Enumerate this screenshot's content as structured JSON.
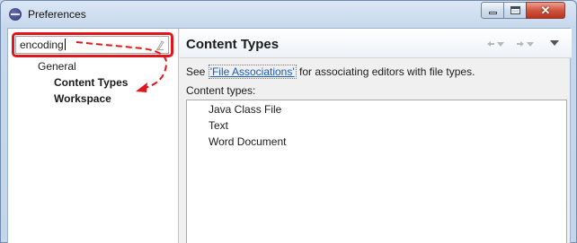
{
  "window": {
    "title": "Preferences",
    "minimize_icon": "minimize-icon",
    "maximize_icon": "maximize-icon",
    "close_icon": "close-icon"
  },
  "filter": {
    "value": "encoding",
    "clear_icon": "eraser-icon"
  },
  "annotation": {
    "highlight_color": "#e0161b"
  },
  "tree": {
    "items": [
      {
        "label": "General",
        "level": 0,
        "bold": false
      },
      {
        "label": "Content Types",
        "level": 1,
        "bold": true
      },
      {
        "label": "Workspace",
        "level": 1,
        "bold": true
      }
    ]
  },
  "page": {
    "title": "Content Types",
    "see_prefix": "See ",
    "see_link": "'File Associations'",
    "see_suffix": " for associating editors with file types.",
    "content_types_label": "Content types:",
    "content_types": [
      "Java Class File",
      "Text",
      "Word Document"
    ],
    "link_color": "#1a5bb8"
  }
}
